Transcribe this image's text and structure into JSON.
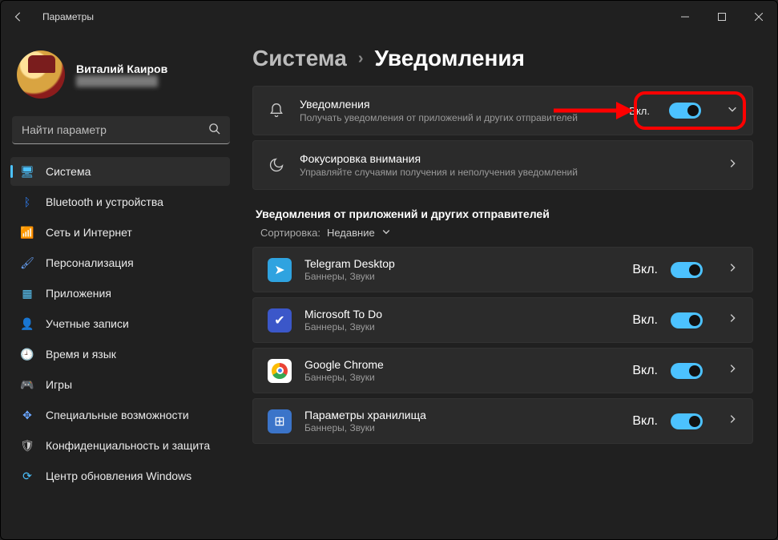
{
  "window": {
    "title": "Параметры"
  },
  "profile": {
    "name": "Виталий Каиров",
    "email": "████████████"
  },
  "search": {
    "placeholder": "Найти параметр"
  },
  "nav": [
    {
      "id": "system",
      "label": "Система",
      "active": true,
      "iconColor": "#4cc2ff",
      "glyph": "🖥"
    },
    {
      "id": "bluetooth",
      "label": "Bluetooth и устройства",
      "iconColor": "#2f7ff5",
      "glyph": "ᛒ"
    },
    {
      "id": "network",
      "label": "Сеть и Интернет",
      "iconColor": "#2fb8f5",
      "glyph": "📶"
    },
    {
      "id": "personalization",
      "label": "Персонализация",
      "iconColor": "#6aa6ff",
      "glyph": "🖌"
    },
    {
      "id": "apps",
      "label": "Приложения",
      "iconColor": "#5ac8fa",
      "glyph": "▦"
    },
    {
      "id": "accounts",
      "label": "Учетные записи",
      "iconColor": "#ccc",
      "glyph": "👤"
    },
    {
      "id": "time",
      "label": "Время и язык",
      "iconColor": "#ccc",
      "glyph": "🕘"
    },
    {
      "id": "gaming",
      "label": "Игры",
      "iconColor": "#ccc",
      "glyph": "🎮"
    },
    {
      "id": "accessibility",
      "label": "Специальные возможности",
      "iconColor": "#6aa6ff",
      "glyph": "✥"
    },
    {
      "id": "privacy",
      "label": "Конфиденциальность и защита",
      "iconColor": "#ccc",
      "glyph": "🛡"
    },
    {
      "id": "update",
      "label": "Центр обновления Windows",
      "iconColor": "#4cc2ff",
      "glyph": "⟳"
    }
  ],
  "breadcrumb": {
    "root": "Система",
    "leaf": "Уведомления"
  },
  "cards": {
    "notifications": {
      "title": "Уведомления",
      "desc": "Получать уведомления от приложений и других отправителей",
      "state": "Вкл."
    },
    "focus": {
      "title": "Фокусировка внимания",
      "desc": "Управляйте случаями получения и неполучения уведомлений"
    }
  },
  "section_title": "Уведомления от приложений и других отправителей",
  "sort": {
    "label": "Сортировка:",
    "value": "Недавние"
  },
  "apps": [
    {
      "id": "telegram",
      "name": "Telegram Desktop",
      "desc": "Баннеры, Звуки",
      "state": "Вкл.",
      "bg": "#2fa3e0",
      "glyph": "➤"
    },
    {
      "id": "todo",
      "name": "Microsoft To Do",
      "desc": "Баннеры, Звуки",
      "state": "Вкл.",
      "bg": "#3b57c9",
      "glyph": "✔"
    },
    {
      "id": "chrome",
      "name": "Google Chrome",
      "desc": "Баннеры, Звуки",
      "state": "Вкл.",
      "bg": "#fff",
      "glyph": "◉"
    },
    {
      "id": "storage",
      "name": "Параметры хранилища",
      "desc": "Баннеры, Звуки",
      "state": "Вкл.",
      "bg": "#3b74c9",
      "glyph": "⊞"
    }
  ]
}
